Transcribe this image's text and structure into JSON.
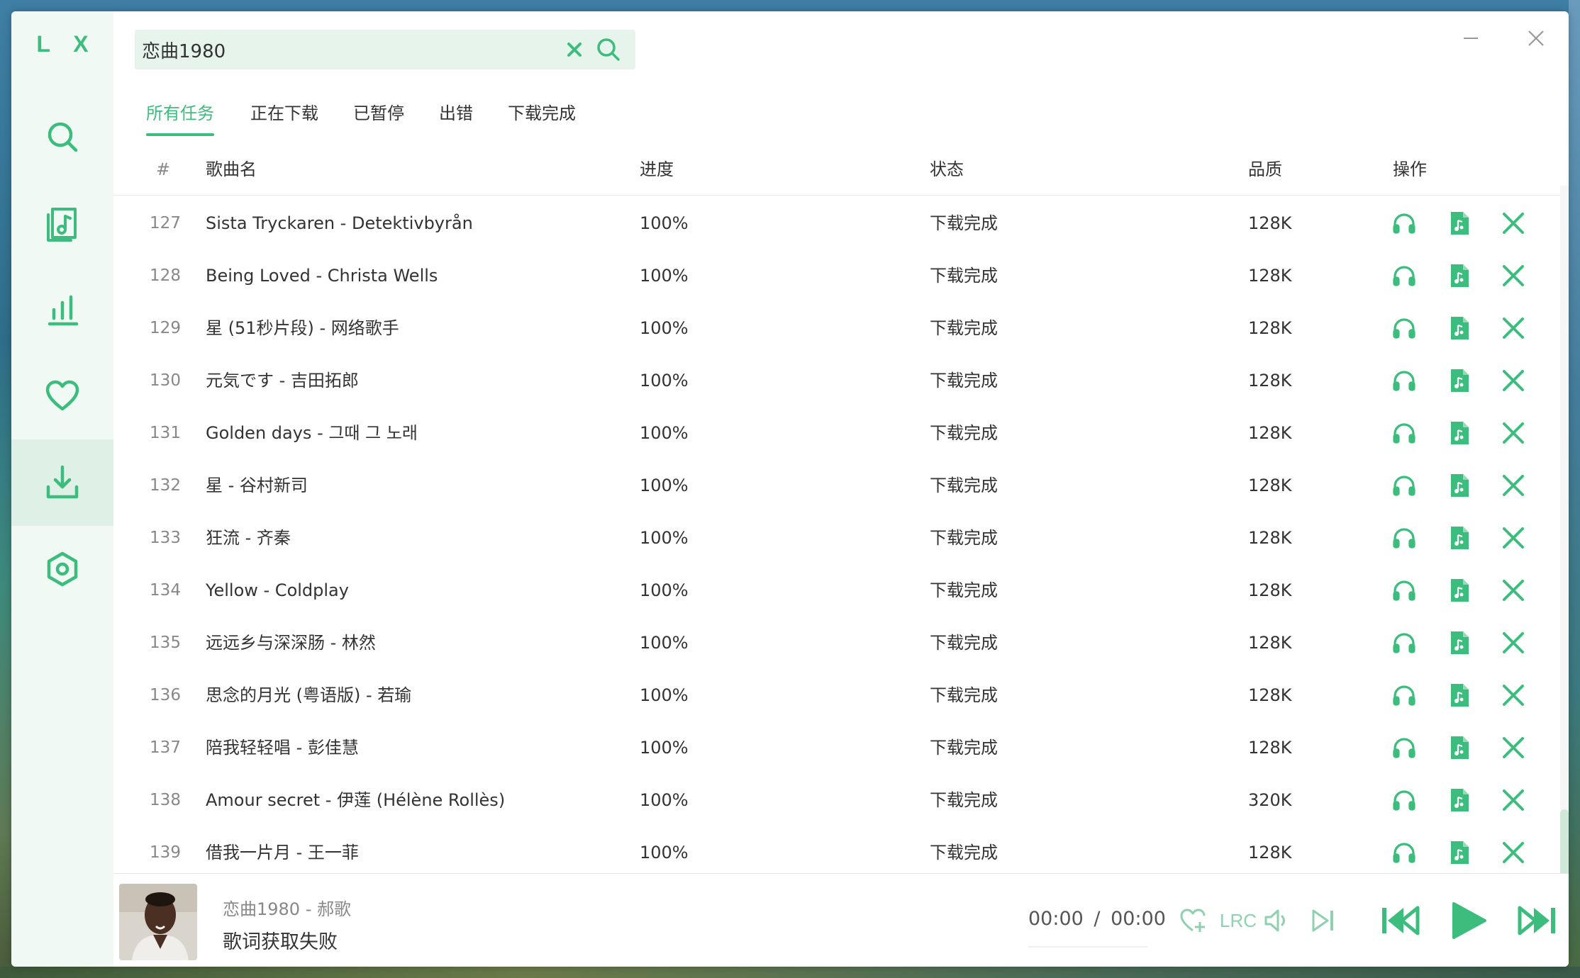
{
  "app": {
    "logo": "L X",
    "accent": "#3dbd7d"
  },
  "sidebar": {
    "items": [
      {
        "name": "search",
        "icon": "search-icon"
      },
      {
        "name": "song-list",
        "icon": "music-doc-icon"
      },
      {
        "name": "leaderboard",
        "icon": "bar-chart-icon"
      },
      {
        "name": "favorites",
        "icon": "heart-icon"
      },
      {
        "name": "download",
        "icon": "download-icon",
        "active": true
      },
      {
        "name": "settings",
        "icon": "settings-icon"
      }
    ]
  },
  "search": {
    "value": "恋曲1980"
  },
  "tabs": [
    {
      "label": "所有任务",
      "active": true
    },
    {
      "label": "正在下载"
    },
    {
      "label": "已暂停"
    },
    {
      "label": "出错"
    },
    {
      "label": "下载完成"
    }
  ],
  "table": {
    "headers": {
      "num": "#",
      "name": "歌曲名",
      "progress": "进度",
      "status": "状态",
      "quality": "品质",
      "actions": "操作"
    },
    "rows": [
      {
        "num": "127",
        "name": "Sista Tryckaren - Detektivbyrån",
        "progress": "100%",
        "status": "下载完成",
        "quality": "128K"
      },
      {
        "num": "128",
        "name": "Being Loved - Christa Wells",
        "progress": "100%",
        "status": "下载完成",
        "quality": "128K"
      },
      {
        "num": "129",
        "name": "星 (51秒片段) - 网络歌手",
        "progress": "100%",
        "status": "下载完成",
        "quality": "128K"
      },
      {
        "num": "130",
        "name": "元気です - 吉田拓郎",
        "progress": "100%",
        "status": "下载完成",
        "quality": "128K"
      },
      {
        "num": "131",
        "name": "Golden days - 그때 그 노래",
        "progress": "100%",
        "status": "下载完成",
        "quality": "128K"
      },
      {
        "num": "132",
        "name": "星 - 谷村新司",
        "progress": "100%",
        "status": "下载完成",
        "quality": "128K"
      },
      {
        "num": "133",
        "name": "狂流 - 齐秦",
        "progress": "100%",
        "status": "下载完成",
        "quality": "128K"
      },
      {
        "num": "134",
        "name": "Yellow - Coldplay",
        "progress": "100%",
        "status": "下载完成",
        "quality": "128K"
      },
      {
        "num": "135",
        "name": "远远乡与深深肠 - 林然",
        "progress": "100%",
        "status": "下载完成",
        "quality": "128K"
      },
      {
        "num": "136",
        "name": "思念的月光 (粤语版) - 若瑜",
        "progress": "100%",
        "status": "下载完成",
        "quality": "128K"
      },
      {
        "num": "137",
        "name": "陪我轻轻唱 - 彭佳慧",
        "progress": "100%",
        "status": "下载完成",
        "quality": "128K"
      },
      {
        "num": "138",
        "name": "Amour secret - 伊莲 (Hélène Rollès)",
        "progress": "100%",
        "status": "下载完成",
        "quality": "320K"
      },
      {
        "num": "139",
        "name": "借我一片月 - 王一菲",
        "progress": "100%",
        "status": "下载完成",
        "quality": "128K"
      }
    ],
    "row_actions": [
      "headphones-icon",
      "music-file-icon",
      "close-icon"
    ]
  },
  "player": {
    "title": "恋曲1980 - 郝歌",
    "lyric": "歌词获取失败",
    "time_current": "00:00",
    "time_separator": "/",
    "time_total": "00:00",
    "lrc_label": "LRC"
  }
}
